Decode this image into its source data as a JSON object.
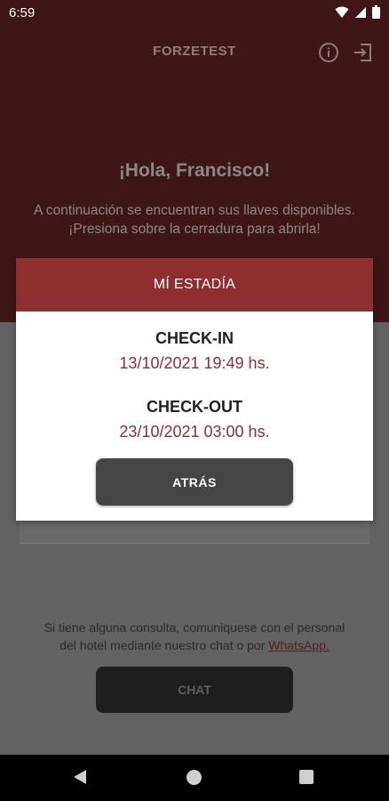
{
  "status_bar": {
    "time": "6:59"
  },
  "header": {
    "title": "FORZETEST"
  },
  "welcome": {
    "greeting": "¡Hola, Francisco!",
    "line1": "A continuación se encuentran sus llaves disponibles.",
    "line2": "¡Presiona sobre la cerradura para abrirla!"
  },
  "dialog": {
    "title": "MÍ ESTADÍA",
    "checkin_label": "CHECK-IN",
    "checkin_value": "13/10/2021 19:49 hs.",
    "checkout_label": "CHECK-OUT",
    "checkout_value": "23/10/2021 03:00 hs.",
    "back_label": "ATRÁS"
  },
  "footer": {
    "line1": "Si tiene alguna consulta, comuniquese con el personal",
    "line2_prefix": "del hotel mediante nuestro chat o por ",
    "link": "WhatsApp.",
    "chat_label": "CHAT"
  },
  "colors": {
    "brand": "#8e2e2e",
    "header_dimmed": "#3e1616"
  },
  "icons": [
    "wifi-icon",
    "signal-icon",
    "battery-icon",
    "info-icon",
    "logout-icon",
    "nav-back-icon",
    "nav-home-icon",
    "nav-recent-icon"
  ]
}
